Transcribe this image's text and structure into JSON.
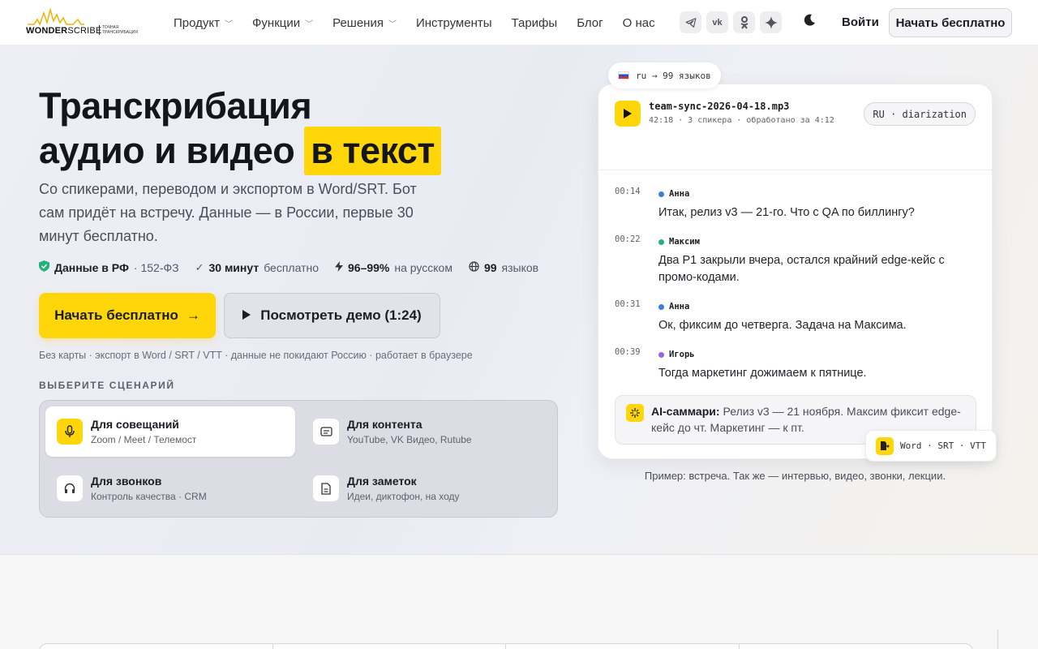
{
  "header": {
    "logo_word": "WONDER",
    "logo_word2": "SCRIBE",
    "logo_tagline": "ТОЧНАЯ ТРАНСКРИБАЦИЯ",
    "nav": [
      {
        "label": "Продукт",
        "dropdown": true
      },
      {
        "label": "Функции",
        "dropdown": true
      },
      {
        "label": "Решения",
        "dropdown": true
      },
      {
        "label": "Инструменты",
        "dropdown": false
      },
      {
        "label": "Тарифы",
        "dropdown": false
      },
      {
        "label": "Блог",
        "dropdown": false
      },
      {
        "label": "О нас",
        "dropdown": false
      }
    ],
    "social_icons": [
      "telegram-icon",
      "vk-icon",
      "odnoklassniki-icon",
      "sparkle-icon"
    ],
    "theme_icon": "moon-icon",
    "login": "Войти",
    "cta": "Начать бесплатно"
  },
  "hero": {
    "title_line1": "Транскрибация",
    "title_line2": "аудио и видео",
    "title_highlight": "в текст",
    "lead": "Со спикерами, переводом и экспортом в Word/SRT. Бот сам придёт на встречу. Данные — в России, первые 30 минут бесплатно.",
    "facts": [
      {
        "icon": "shield-icon",
        "bold": "Данные в РФ",
        "text": "· 152-ФЗ"
      },
      {
        "icon": "check-icon",
        "bold": "30 минут",
        "text": "бесплатно"
      },
      {
        "icon": "bolt-icon",
        "bold": "96–99%",
        "text": "на русском"
      },
      {
        "icon": "globe-icon",
        "bold": "99",
        "text": "языков"
      }
    ],
    "primary_cta": "Начать бесплатно",
    "primary_arrow": "→",
    "demo_cta": "Посмотреть демо (1:24)",
    "note": "Без карты · экспорт в Word / SRT / VTT · данные не покидают Россию · работает в браузере",
    "scenarios_title": "ВЫБЕРИТЕ СЦЕНАРИЙ",
    "scenarios": [
      {
        "icon": "microphone-icon",
        "name": "Для совещаний",
        "desc": "Zoom / Meet / Телемост",
        "active": true
      },
      {
        "icon": "video-icon",
        "name": "Для контента",
        "desc": "YouTube, VK Видео, Rutube",
        "active": false
      },
      {
        "icon": "headphones-icon",
        "name": "Для звонков",
        "desc": "Контроль качества · CRM",
        "active": false
      },
      {
        "icon": "note-icon",
        "name": "Для заметок",
        "desc": "Идеи, диктофон, на ходу",
        "active": false
      }
    ]
  },
  "demo_card": {
    "lang_pill": "ru → 99 языков",
    "file_name": "team-sync-2026-04-18.mp3",
    "file_meta": "42:18 · 3 спикера · обработано за 4:12",
    "badge": "RU · diarization",
    "utterances": [
      {
        "time": "00:14",
        "speaker": "Анна",
        "color": "#3b7ddd",
        "text": "Итак, релиз v3 — 21-го. Что с QA по биллингу?"
      },
      {
        "time": "00:22",
        "speaker": "Максим",
        "color": "#22b07d",
        "text": "Два P1 закрыли вчера, остался крайний edge-кейс с промо-кодами."
      },
      {
        "time": "00:31",
        "speaker": "Анна",
        "color": "#3b7ddd",
        "text": "Ок, фиксим до четверга. Задача на Максима."
      },
      {
        "time": "00:39",
        "speaker": "Игорь",
        "color": "#9a62e0",
        "text": "Тогда маркетинг дожимаем к пятнице."
      }
    ],
    "summary_label": "AI-саммари:",
    "summary_text": "Релиз v3 — 21 ноября. Максим фиксит edge-кейс до чт. Маркетинг — к пт.",
    "export_pill": "Word · SRT · VTT",
    "caption": "Пример: встреча. Так же — интервью, видео, звонки, лекции."
  },
  "colors": {
    "accent": "#ffd60a",
    "text": "#1b1d24",
    "muted": "#5e616a"
  }
}
